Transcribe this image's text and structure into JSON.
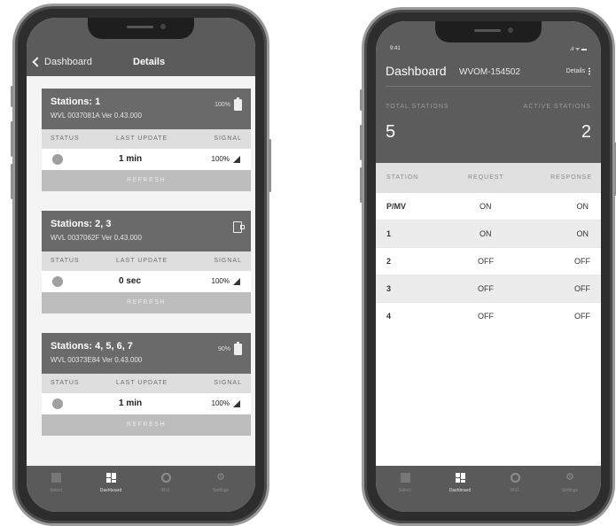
{
  "left": {
    "header": {
      "back_label": "Dashboard",
      "title": "Details"
    },
    "columns": {
      "status": "STATUS",
      "last_update": "LAST UPDATE",
      "signal": "SIGNAL"
    },
    "cards": [
      {
        "title": "Stations: 1",
        "sub": "WVL 0037081A  Ver 0.43.000",
        "battery": "100%",
        "last_update": "1 min",
        "signal": "100%",
        "refresh": "REFRESH"
      },
      {
        "title": "Stations: 2, 3",
        "sub": "WVL 0037062F  Ver 0.43.000",
        "battery": "",
        "last_update": "0 sec",
        "signal": "100%",
        "refresh": "REFRESH"
      },
      {
        "title": "Stations: 4, 5, 6, 7",
        "sub": "WVL 00373E84  Ver 0.43.000",
        "battery": "90%",
        "last_update": "1 min",
        "signal": "100%",
        "refresh": "REFRESH"
      }
    ],
    "tabs": [
      "Select",
      "Dashboard",
      "WVL",
      "Settings"
    ]
  },
  "right": {
    "status": {
      "time": "9:41",
      "icons": ".ıl ᯤ ▬"
    },
    "header": {
      "title": "Dashboard",
      "device": "WVOM-154502",
      "details": "Details"
    },
    "summary": {
      "total_label": "TOTAL STATIONS",
      "total_value": "5",
      "active_label": "ACTIVE STATIONS",
      "active_value": "2"
    },
    "columns": {
      "station": "STATION",
      "request": "REQUEST",
      "response": "RESPONSE"
    },
    "rows": [
      {
        "station": "P/MV",
        "request": "ON",
        "response": "ON"
      },
      {
        "station": "1",
        "request": "ON",
        "response": "ON"
      },
      {
        "station": "2",
        "request": "OFF",
        "response": "OFF"
      },
      {
        "station": "3",
        "request": "OFF",
        "response": "OFF"
      },
      {
        "station": "4",
        "request": "OFF",
        "response": "OFF"
      }
    ],
    "tabs": [
      "Select",
      "Dashboard",
      "WVL",
      "Settings"
    ]
  }
}
